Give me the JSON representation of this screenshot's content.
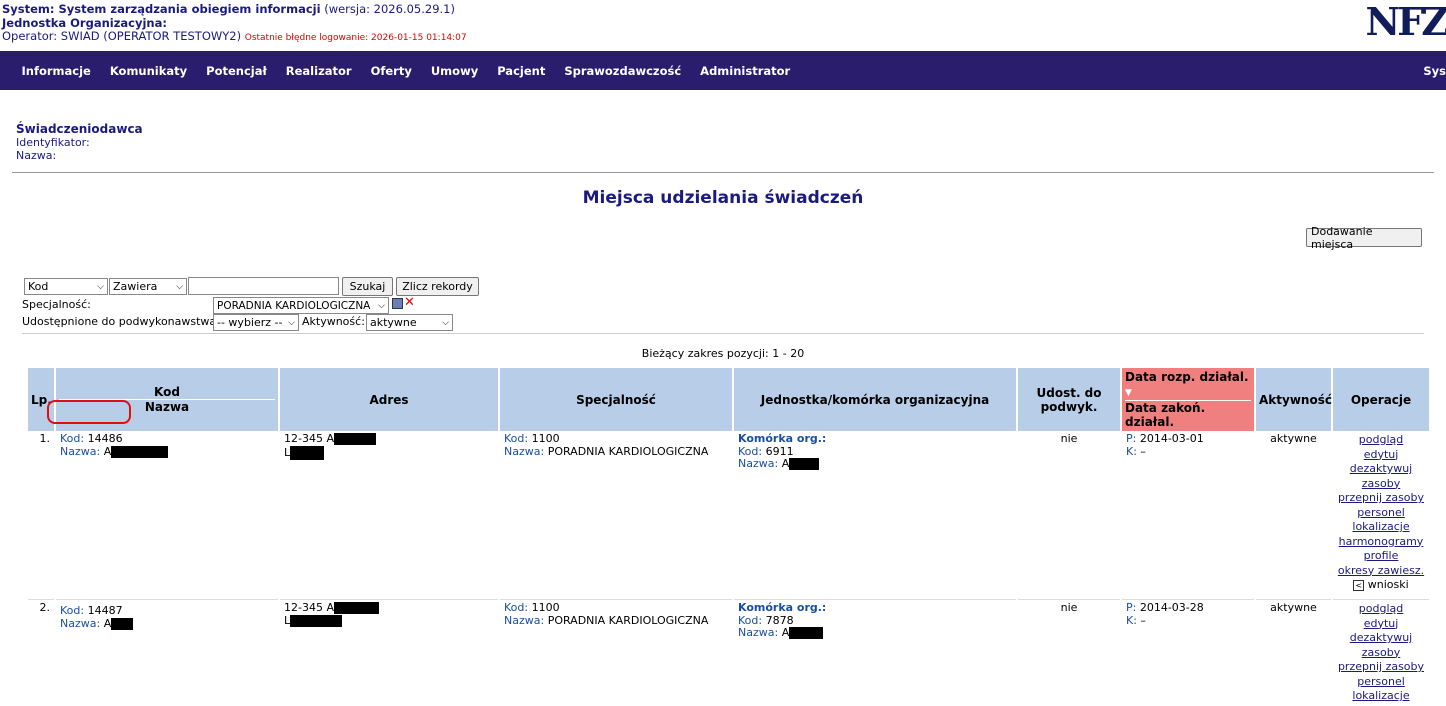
{
  "header": {
    "system_label": "System: System zarządzania obiegiem informacji",
    "version": "(wersja: 2026.05.29.1)",
    "unit_label": "Jednostka Organizacyjna:",
    "operator": "Operator: SWIAD (OPERATOR TESTOWY2)",
    "last_failed": "Ostatnie błędne logowanie: 2026-01-15 01:14:07",
    "logo": "NFZ"
  },
  "menu": [
    "Informacje",
    "Komunikaty",
    "Potencjał",
    "Realizator",
    "Oferty",
    "Umowy",
    "Pacjent",
    "Sprawozdawczość",
    "Administrator"
  ],
  "menu_right": "Sys",
  "provider": {
    "title": "Świadczeniodawca",
    "id_label": "Identyfikator:",
    "name_label": "Nazwa:"
  },
  "page_title": "Miejsca udzielania świadczeń",
  "add_button": "Dodawanie miejsca",
  "filters": {
    "field_select": "Kod",
    "op_select": "Zawiera",
    "search_value": "",
    "search_button": "Szukaj",
    "count_button": "Zlicz rekordy",
    "specialty_label": "Specjalność:",
    "specialty_value": "PORADNIA KARDIOLOGICZNA",
    "subcontract_label": "Udostępnione do podwykonawstwa:",
    "subcontract_value": "-- wybierz --",
    "activity_label": "Aktywność:",
    "activity_value": "aktywne"
  },
  "range_text": "Bieżący zakres pozycji: 1 - 20",
  "columns": {
    "lp": "Lp.",
    "kod": "Kod",
    "nazwa": "Nazwa",
    "adres": "Adres",
    "spec": "Specjalność",
    "unit": "Jednostka/komórka organizacyjna",
    "udost": "Udost. do podwyk.",
    "date_start": "Data rozp. działal.",
    "date_end": "Data zakoń. działal.",
    "akt": "Aktywność",
    "ops": "Operacje"
  },
  "labels": {
    "kod": "Kod:",
    "nazwa": "Nazwa:",
    "komorka": "Komórka org.:",
    "p": "P:",
    "k": "K:"
  },
  "rows": [
    {
      "lp": "1.",
      "kod": "14486",
      "nazwa": "A",
      "adres1": "12-345 A",
      "adres2": "L",
      "spec_kod": "1100",
      "spec_nazwa": "PORADNIA KARDIOLOGICZNA",
      "unit_kod": "6911",
      "unit_nazwa": "A",
      "udost": "nie",
      "p": "2014-03-01",
      "k": "–",
      "akt": "aktywne",
      "ops": [
        "podgląd",
        "edytuj",
        "dezaktywuj",
        "zasoby",
        "przepnij zasoby",
        "personel",
        "lokalizacje",
        "harmonogramy",
        "profile",
        "okresy zawiesz."
      ],
      "wnioski": "wnioski"
    },
    {
      "lp": "2.",
      "kod": "14487",
      "nazwa": "A",
      "adres1": "12-345 A",
      "adres2": "L",
      "spec_kod": "1100",
      "spec_nazwa": "PORADNIA KARDIOLOGICZNA",
      "unit_kod": "7878",
      "unit_nazwa": "A",
      "udost": "nie",
      "p": "2014-03-28",
      "k": "–",
      "akt": "aktywne",
      "ops": [
        "podgląd",
        "edytuj",
        "dezaktywuj",
        "zasoby",
        "przepnij zasoby",
        "personel",
        "lokalizacje"
      ]
    }
  ],
  "colors": {
    "menubar": "#2b1d6e",
    "header_cell": "#b7cde8",
    "sorted_cell": "#f08080",
    "link": "#1a1a80"
  }
}
